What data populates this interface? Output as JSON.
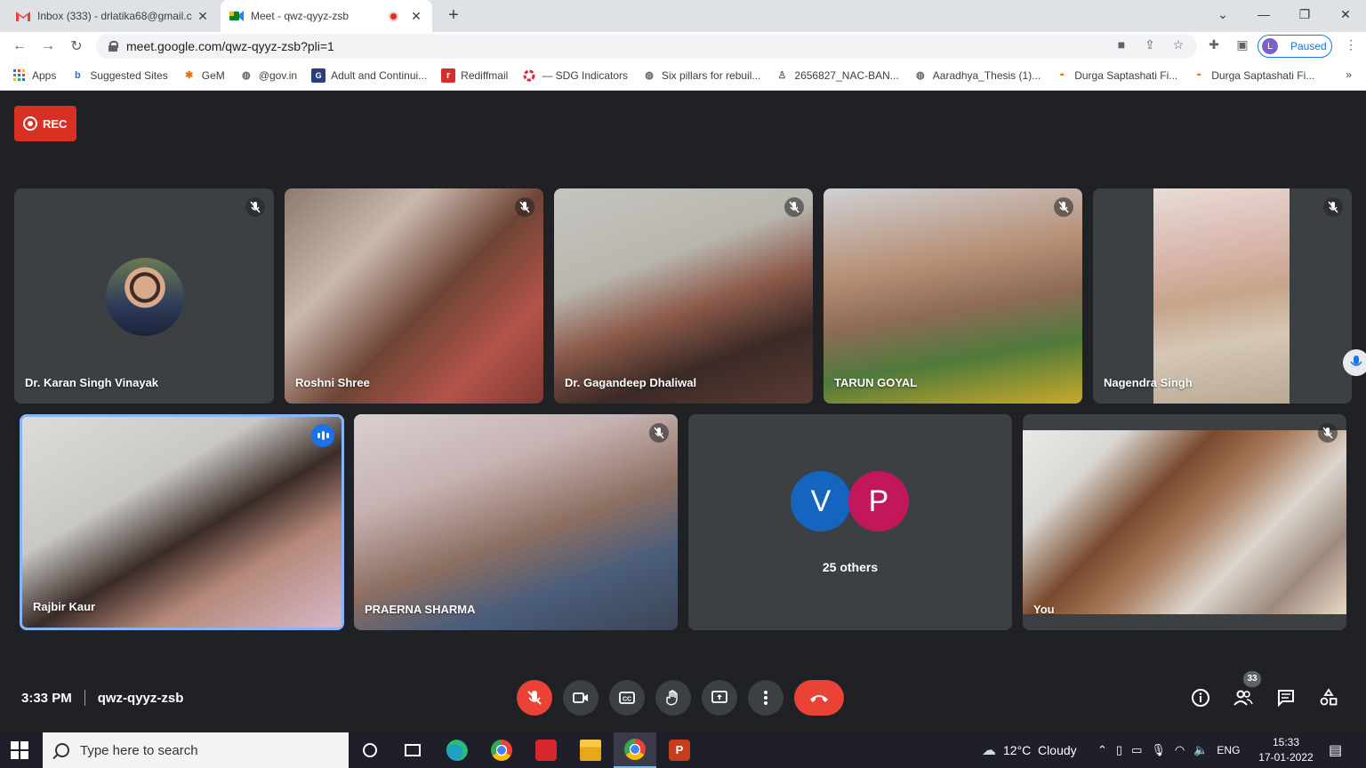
{
  "browser": {
    "tabs": [
      {
        "title": "Inbox (333) - drlatika68@gmail.c",
        "icon": "gmail-icon"
      },
      {
        "title": "Meet - qwz-qyyz-zsb",
        "icon": "meet-icon"
      }
    ],
    "url": "meet.google.com/qwz-qyyz-zsb?pli=1",
    "profile_initial": "L",
    "profile_status": "Paused"
  },
  "bookmarks": [
    {
      "label": "Apps",
      "icon": "apps-grid-icon"
    },
    {
      "label": "Suggested Sites",
      "icon": "bing-icon"
    },
    {
      "label": "GeM",
      "icon": "gem-icon"
    },
    {
      "label": "@gov.in",
      "icon": "globe-icon"
    },
    {
      "label": "Adult and Continui...",
      "icon": "site-icon"
    },
    {
      "label": "Rediffmail",
      "icon": "rediff-icon"
    },
    {
      "label": "— SDG Indicators",
      "icon": "sdg-icon"
    },
    {
      "label": "Six pillars for rebuil...",
      "icon": "globe-icon"
    },
    {
      "label": "2656827_NAC-BAN...",
      "icon": "site-icon"
    },
    {
      "label": "Aaradhya_Thesis (1)...",
      "icon": "globe-icon"
    },
    {
      "label": "Durga Saptashati Fi...",
      "icon": "diya-icon"
    },
    {
      "label": "Durga Saptashati Fi...",
      "icon": "diya-icon"
    }
  ],
  "bookmarks_more": "»",
  "meet": {
    "rec_label": "REC",
    "participants_row1": [
      {
        "name": "Dr. Karan Singh Vinayak"
      },
      {
        "name": "Roshni Shree"
      },
      {
        "name": "Dr. Gagandeep Dhaliwal"
      },
      {
        "name": "TARUN GOYAL"
      },
      {
        "name": "Nagendra Singh"
      }
    ],
    "participants_row2": [
      {
        "name": "Rajbir Kaur"
      },
      {
        "name": "PRAERNA SHARMA"
      },
      {
        "name": "You"
      }
    ],
    "others": {
      "initials": [
        "V",
        "P"
      ],
      "label": "25 others",
      "colors": [
        "#1565c0",
        "#c2185b"
      ]
    },
    "time": "3:33 PM",
    "meeting_code": "qwz-qyyz-zsb",
    "participant_count": "33"
  },
  "taskbar": {
    "search_placeholder": "Type here to search",
    "weather": "12°C  Cloudy",
    "language": "ENG",
    "time": "15:33",
    "date": "17-01-2022"
  },
  "colors": {
    "accent": "#1a73e8",
    "danger": "#ea4335",
    "stage": "#202124",
    "tile": "#3c4043"
  }
}
